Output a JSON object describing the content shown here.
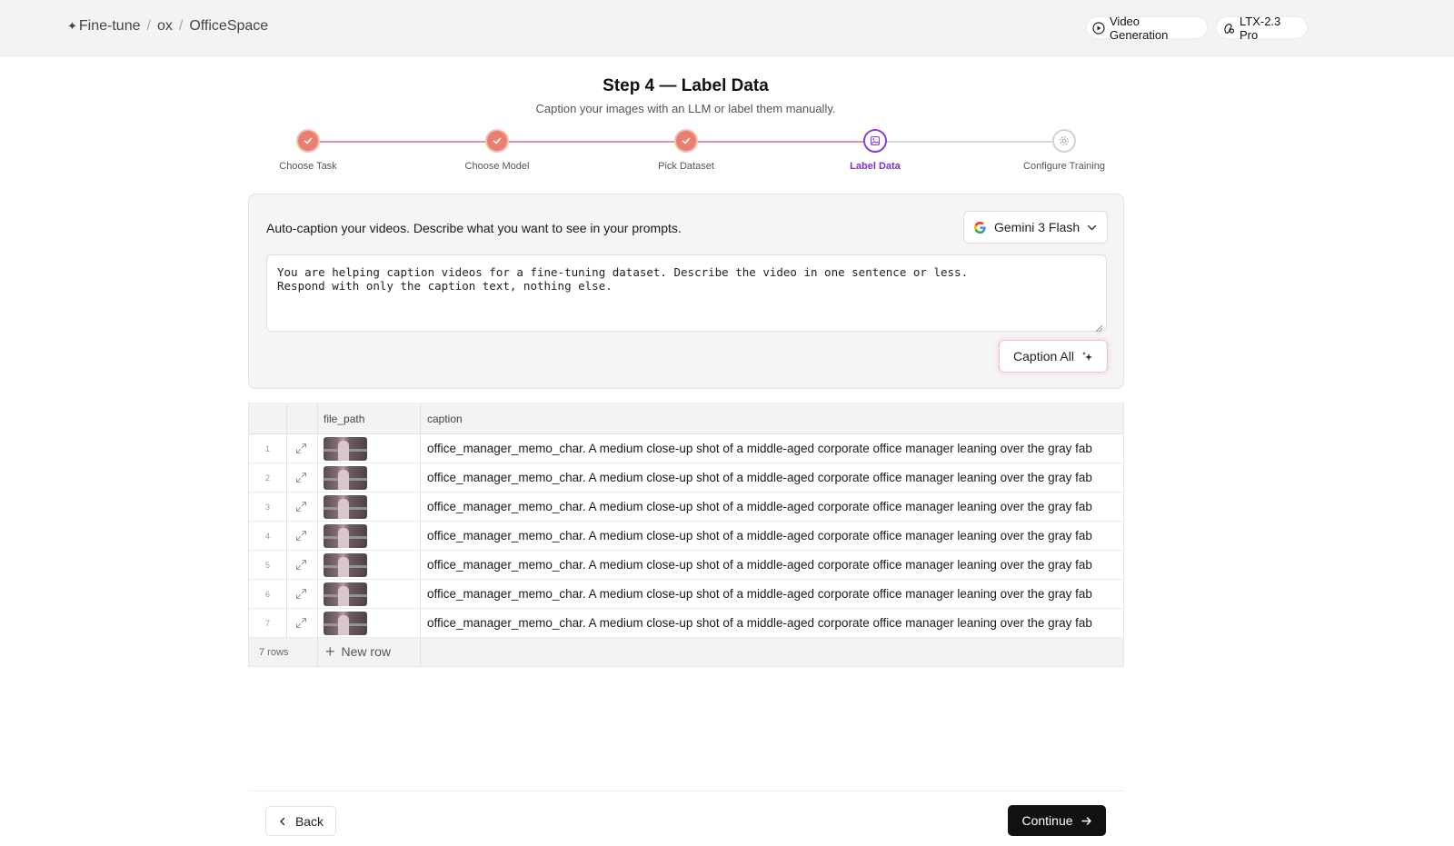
{
  "breadcrumb": {
    "root": "Fine-tune",
    "org": "ox",
    "project": "OfficeSpace"
  },
  "header_pills": {
    "video_generation": "Video Generation",
    "model": "LTX-2.3 Pro"
  },
  "page": {
    "title": "Step 4 — Label Data",
    "subtitle": "Caption your images with an LLM or label them manually."
  },
  "stepper": {
    "current_step": 4,
    "steps": [
      {
        "label": "Choose Task",
        "state": "done"
      },
      {
        "label": "Choose Model",
        "state": "done"
      },
      {
        "label": "Pick Dataset",
        "state": "done"
      },
      {
        "label": "Label Data",
        "state": "active"
      },
      {
        "label": "Configure Training",
        "state": "todo"
      }
    ]
  },
  "autocaption": {
    "heading": "Auto-caption your videos. Describe what you want to see in your prompts.",
    "model": "Gemini 3 Flash",
    "prompt": "You are helping caption videos for a fine-tuning dataset. Describe the video in one sentence or less.\nRespond with only the caption text, nothing else.",
    "caption_all_label": "Caption All"
  },
  "table": {
    "columns": [
      "file_path",
      "caption"
    ],
    "rows": [
      {
        "n": "1",
        "caption": "office_manager_memo_char. A medium close-up shot of a middle-aged corporate office manager leaning over the gray fab"
      },
      {
        "n": "2",
        "caption": "office_manager_memo_char. A medium close-up shot of a middle-aged corporate office manager leaning over the gray fab"
      },
      {
        "n": "3",
        "caption": "office_manager_memo_char. A medium close-up shot of a middle-aged corporate office manager leaning over the gray fab"
      },
      {
        "n": "4",
        "caption": "office_manager_memo_char. A medium close-up shot of a middle-aged corporate office manager leaning over the gray fab"
      },
      {
        "n": "5",
        "caption": "office_manager_memo_char. A medium close-up shot of a middle-aged corporate office manager leaning over the gray fab"
      },
      {
        "n": "6",
        "caption": "office_manager_memo_char. A medium close-up shot of a middle-aged corporate office manager leaning over the gray fab"
      },
      {
        "n": "7",
        "caption": "office_manager_memo_char. A medium close-up shot of a middle-aged corporate office manager leaning over the gray fab"
      }
    ],
    "row_count": "7 rows",
    "new_row_label": "New row"
  },
  "nav": {
    "back_label": "Back",
    "continue_label": "Continue"
  },
  "colors": {
    "step_done": "#e9806f",
    "step_active": "#8a3fd4",
    "primary_button": "#111111"
  },
  "icons": {
    "breadcrumb": "sparkle-icon",
    "video_generation": "play-circle-icon",
    "model": "model-icon",
    "model_select": "google-icon",
    "caption_all": "sparkle-icon",
    "row_expand": "expand-icon",
    "step_done": "check-icon",
    "step_active": "image-icon",
    "step_todo": "gear-icon"
  }
}
